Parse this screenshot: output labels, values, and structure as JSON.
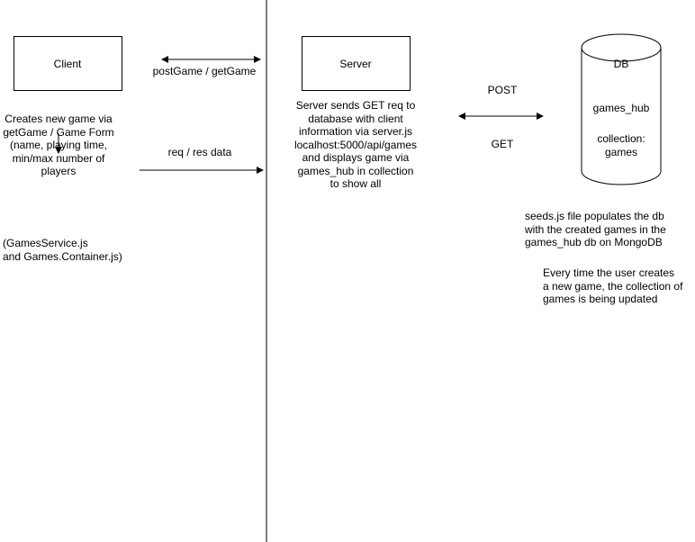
{
  "nodes": {
    "client": "Client",
    "server": "Server",
    "db": "DB",
    "db_name": "games_hub",
    "db_collection": "collection:\ngames"
  },
  "edges": {
    "client_server": "postGame / getGame",
    "req_res": "req / res data",
    "post": "POST",
    "get": "GET"
  },
  "notes": {
    "client_desc": "Creates new game via\ngetGame / Game Form\n(name, playing time,\nmin/max number of\nplayers",
    "client_files": "(GamesService.js\nand Games.Container.js)",
    "server_desc": "Server sends GET req to\ndatabase with client\ninformation via server.js\nlocalhost:5000/api/games\nand displays game via\ngames_hub in collection\nto show all",
    "seeds": "seeds.js file populates the db\nwith the created games in the\ngames_hub db on MongoDB",
    "updates": "Every time the user creates\na new game, the collection of\ngames is being updated"
  }
}
